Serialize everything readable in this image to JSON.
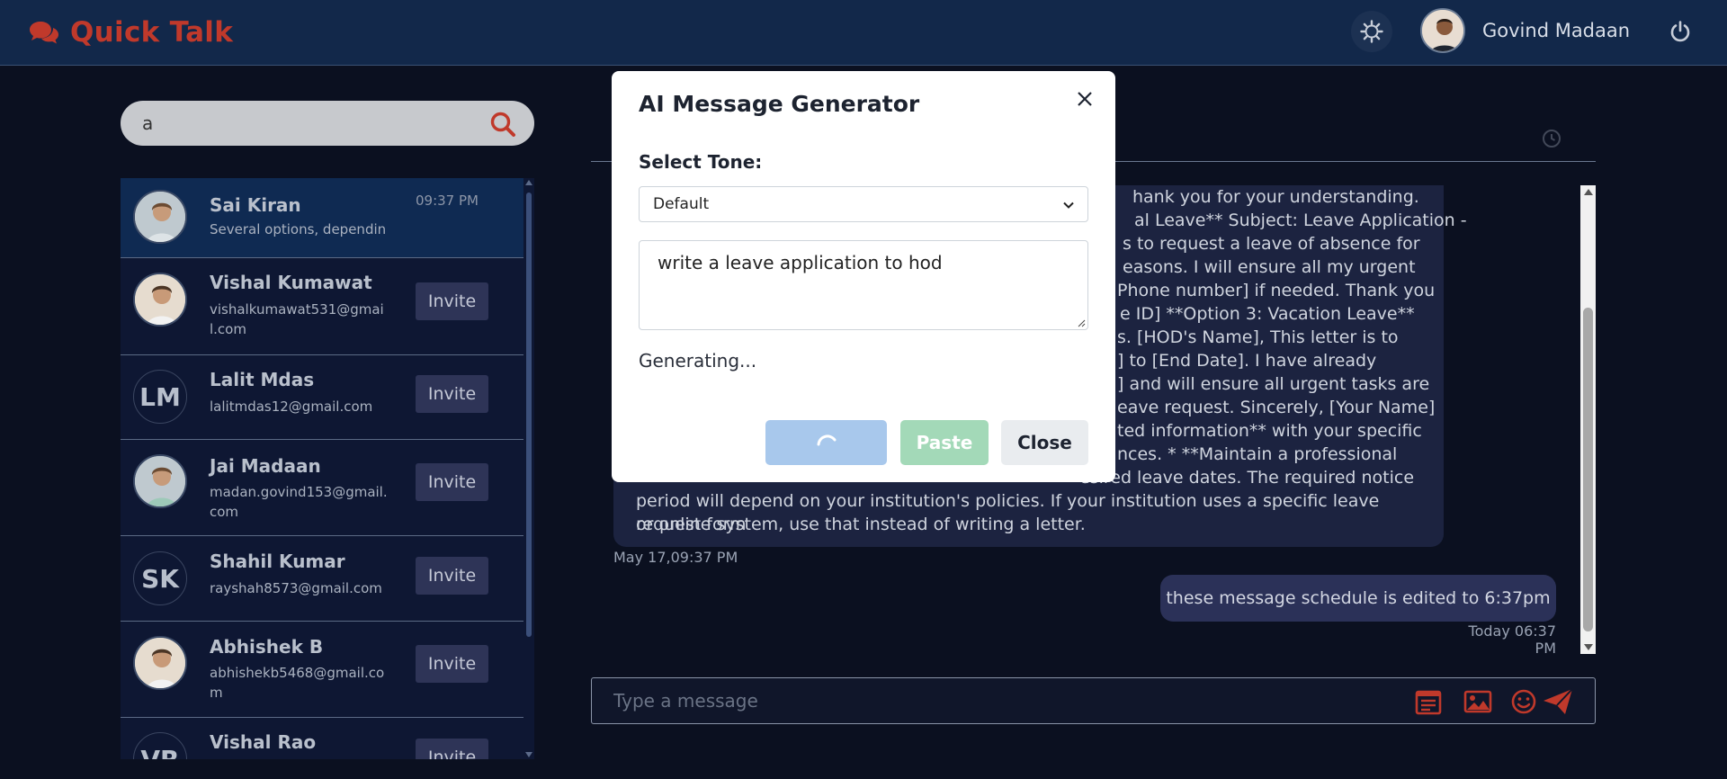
{
  "app": {
    "brand": "Quick Talk",
    "user_name": "Govind Madaan"
  },
  "search": {
    "value": "a"
  },
  "contacts": [
    {
      "name": "Sai Kiran",
      "sub": "Several options, dependin",
      "time": "09:37 PM",
      "avatar": "photo",
      "initials": ""
    },
    {
      "name": "Vishal Kumawat",
      "sub": "vishalkumawat531@gmail.com",
      "action": "Invite",
      "avatar": "photo",
      "initials": ""
    },
    {
      "name": "Lalit Mdas",
      "sub": "lalitmdas12@gmail.com",
      "action": "Invite",
      "avatar": "initials",
      "initials": "LM"
    },
    {
      "name": "Jai Madaan",
      "sub": "madan.govind153@gmail.com",
      "action": "Invite",
      "avatar": "photo",
      "initials": ""
    },
    {
      "name": "Shahil Kumar",
      "sub": "rayshah8573@gmail.com",
      "action": "Invite",
      "avatar": "initials",
      "initials": "SK"
    },
    {
      "name": "Abhishek B",
      "sub": "abhishekb5468@gmail.com",
      "action": "Invite",
      "avatar": "photo",
      "initials": ""
    },
    {
      "name": "Vishal Rao",
      "sub": "",
      "action": "Invite",
      "avatar": "initials",
      "initials": "VR"
    }
  ],
  "chat": {
    "incoming_lines": [
      "hank you for your understanding.",
      "al Leave** Subject: Leave Application -",
      "s to request a leave of absence for",
      "easons. I will ensure all my urgent",
      "Phone number] if needed. Thank you",
      "e ID] **Option 3: Vacation Leave**",
      "s. [HOD's Name], This letter is to",
      "] to [End Date]. I have already",
      "] and will ensure all urgent tasks are",
      "eave request. Sincerely, [Your Name]",
      "ted information** with your specific",
      "nces. * **Maintain a professional",
      "period will depend on your institution's policies. If your institution uses a specific leave request form",
      "or online system, use that instead of writing a letter."
    ],
    "incoming_tail_prefix": "esired leave dates. The required notice",
    "incoming_time": "May 17,09:37 PM",
    "outgoing_text": "these message schedule is edited to 6:37pm",
    "outgoing_time": "Today 06:37 PM",
    "composer_placeholder": "Type a message"
  },
  "modal": {
    "title": "AI Message Generator",
    "tone_label": "Select Tone:",
    "tone_value": "Default",
    "prompt_value": "write a leave application to hod",
    "status": "Generating...",
    "paste_label": "Paste",
    "close_label": "Close"
  },
  "colors": {
    "brand": "#c0392b",
    "header_bg": "#12284a",
    "page_bg": "#0b1020"
  }
}
